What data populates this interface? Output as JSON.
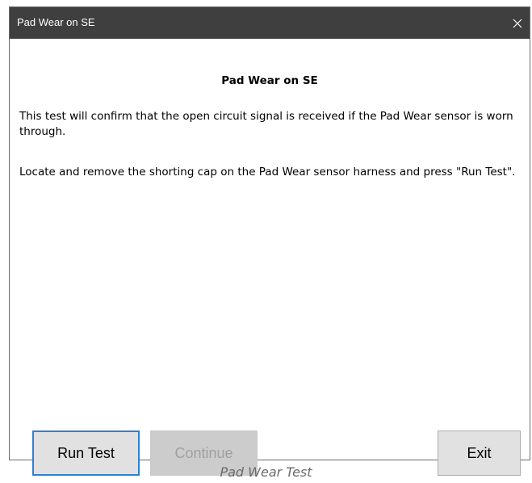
{
  "window": {
    "title": "Pad Wear on SE",
    "close_icon": "close-icon"
  },
  "content": {
    "heading": "Pad Wear on SE",
    "paragraph_1": "This test will confirm that the open circuit signal is received if the Pad Wear sensor is worn through.",
    "paragraph_2": "Locate and remove the shorting cap on the Pad Wear sensor harness and press \"Run Test\"."
  },
  "buttons": {
    "run_test": "Run Test",
    "continue": "Continue",
    "continue_enabled": false,
    "exit": "Exit"
  },
  "caption": "Pad Wear Test",
  "colors": {
    "titlebar": "#3f3f3f",
    "focus_border": "#2f7fd3",
    "button_face": "#e1e1e1",
    "disabled_face": "#cccccc",
    "disabled_text": "#a0a0a0"
  }
}
